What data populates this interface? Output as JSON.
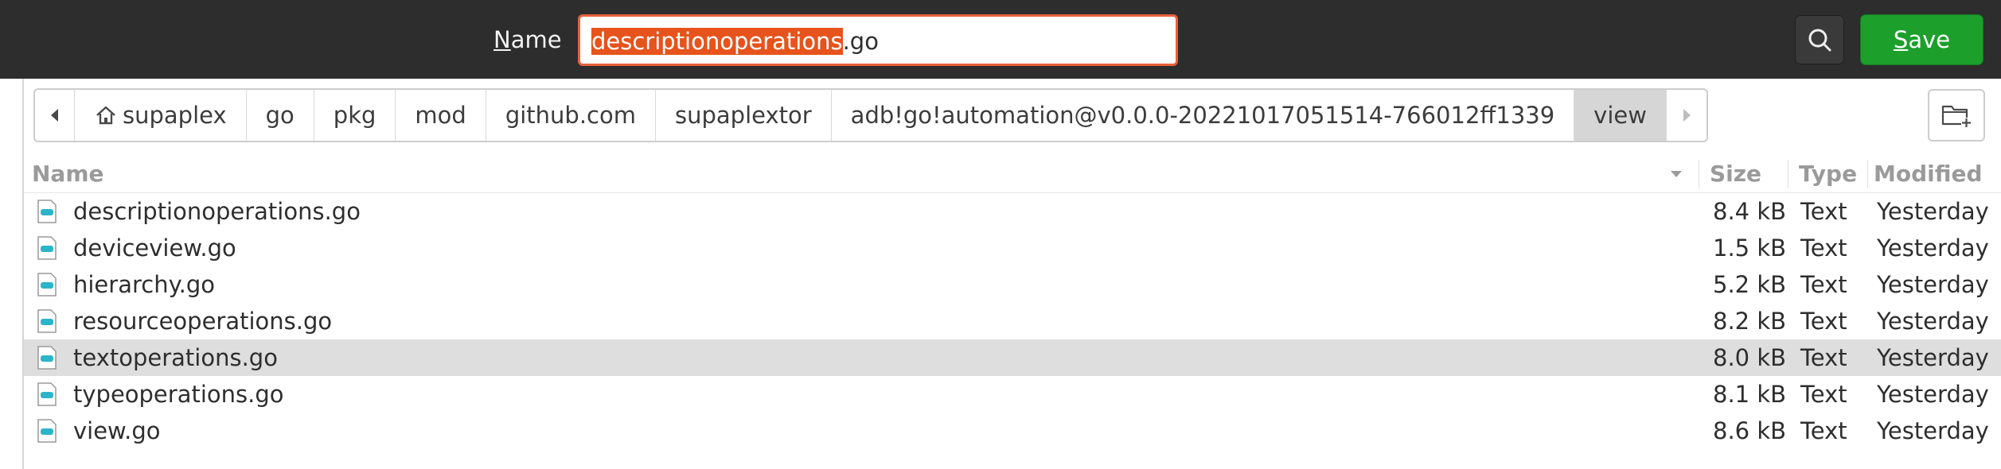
{
  "header": {
    "name_label_mnemonic": "N",
    "name_label_rest": "ame",
    "filename_selected": "descriptionoperations",
    "filename_ext": ".go",
    "save_mnemonic": "S",
    "save_rest": "ave",
    "accent_color": "#e6531c",
    "save_color": "#1c9f2b"
  },
  "breadcrumb": {
    "items": [
      "supaplex",
      "go",
      "pkg",
      "mod",
      "github.com",
      "supaplextor",
      "adb!go!automation@v0.0.0-20221017051514-766012ff1339",
      "view"
    ]
  },
  "table": {
    "columns": {
      "name": "Name",
      "size": "Size",
      "type": "Type",
      "modified": "Modified"
    },
    "rows": [
      {
        "name": "descriptionoperations.go",
        "size": "8.4 kB",
        "type": "Text",
        "modified": "Yesterday"
      },
      {
        "name": "deviceview.go",
        "size": "1.5 kB",
        "type": "Text",
        "modified": "Yesterday"
      },
      {
        "name": "hierarchy.go",
        "size": "5.2 kB",
        "type": "Text",
        "modified": "Yesterday"
      },
      {
        "name": "resourceoperations.go",
        "size": "8.2 kB",
        "type": "Text",
        "modified": "Yesterday"
      },
      {
        "name": "textoperations.go",
        "size": "8.0 kB",
        "type": "Text",
        "modified": "Yesterday"
      },
      {
        "name": "typeoperations.go",
        "size": "8.1 kB",
        "type": "Text",
        "modified": "Yesterday"
      },
      {
        "name": "view.go",
        "size": "8.6 kB",
        "type": "Text",
        "modified": "Yesterday"
      }
    ]
  },
  "icons": {
    "search": "search-icon",
    "new_folder": "new-folder-icon",
    "home": "home-icon",
    "back": "chevron-left-icon",
    "forward": "chevron-right-icon",
    "sort": "sort-descending-icon",
    "file": "go-file-icon"
  }
}
